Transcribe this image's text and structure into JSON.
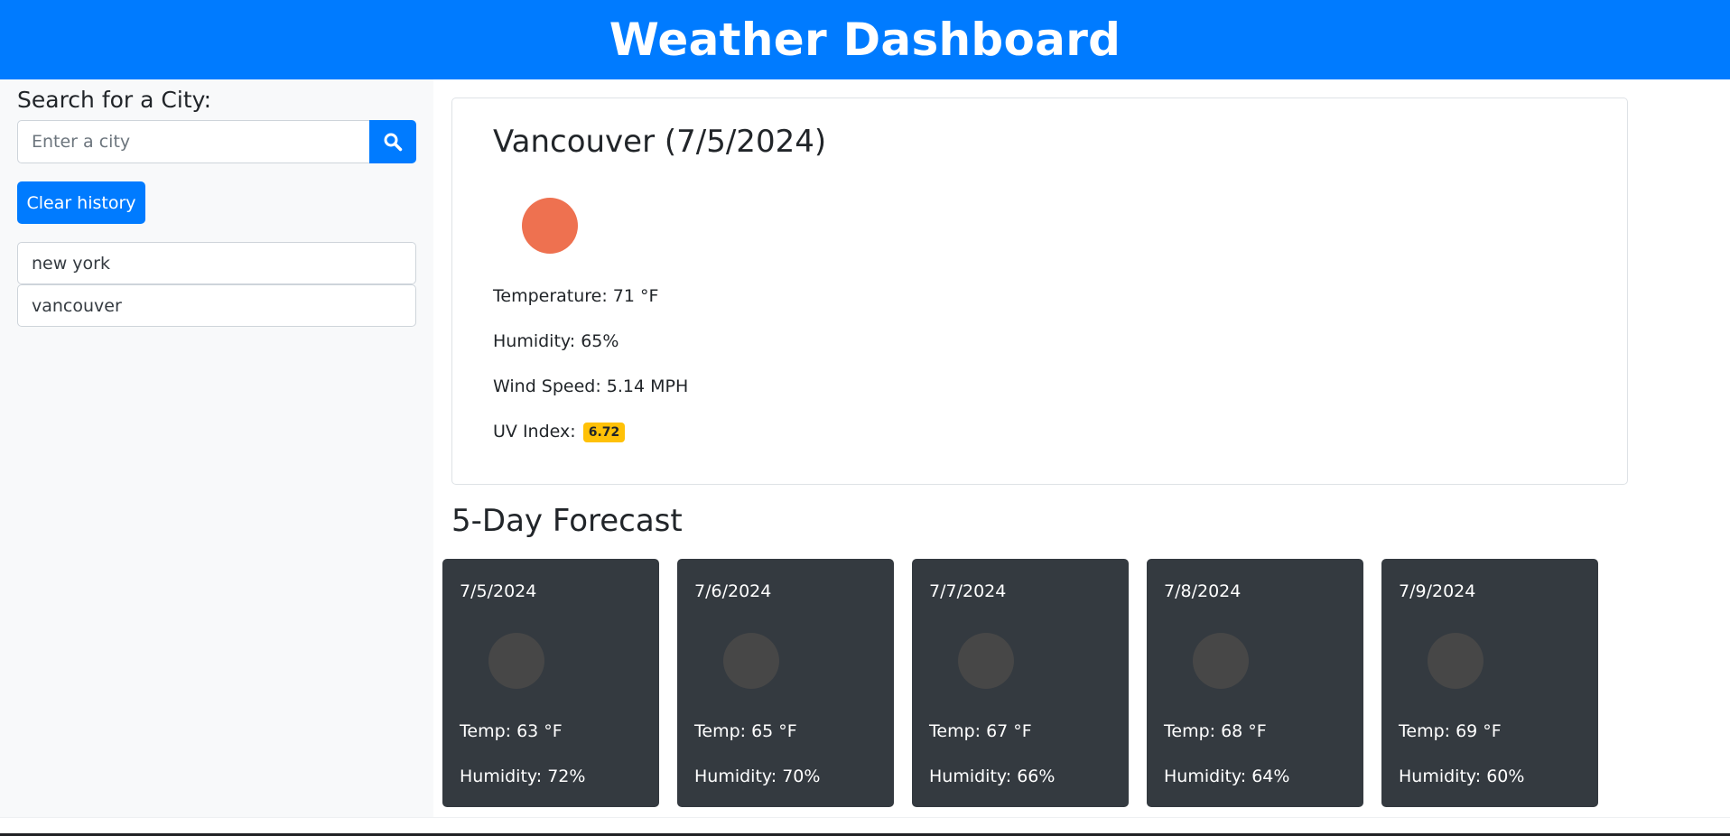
{
  "header": {
    "title": "Weather Dashboard"
  },
  "sidebar": {
    "title": "Search for a City:",
    "search": {
      "placeholder": "Enter a city",
      "value": ""
    },
    "search_icon": "search-icon",
    "clear_label": "Clear history",
    "history": [
      "new york",
      "vancouver"
    ]
  },
  "current": {
    "title": "Vancouver (7/5/2024)",
    "icon": "sun-icon",
    "temperature": "Temperature: 71 °F",
    "humidity": "Humidity: 65%",
    "wind": "Wind Speed: 5.14 MPH",
    "uv_label": "UV Index:",
    "uv_value": "6.72"
  },
  "forecast": {
    "title": "5-Day Forecast",
    "days": [
      {
        "date": "7/5/2024",
        "temp": "Temp: 63 °F",
        "humidity": "Humidity: 72%"
      },
      {
        "date": "7/6/2024",
        "temp": "Temp: 65 °F",
        "humidity": "Humidity: 70%"
      },
      {
        "date": "7/7/2024",
        "temp": "Temp: 67 °F",
        "humidity": "Humidity: 66%"
      },
      {
        "date": "7/8/2024",
        "temp": "Temp: 68 °F",
        "humidity": "Humidity: 64%"
      },
      {
        "date": "7/9/2024",
        "temp": "Temp: 69 °F",
        "humidity": "Humidity: 60%"
      }
    ]
  },
  "colors": {
    "primary": "#007bff",
    "sidebar_bg": "#f8f9fa",
    "forecast_card_bg": "#343a40",
    "uv_badge": "#ffc107",
    "current_icon": "#ee7150"
  }
}
